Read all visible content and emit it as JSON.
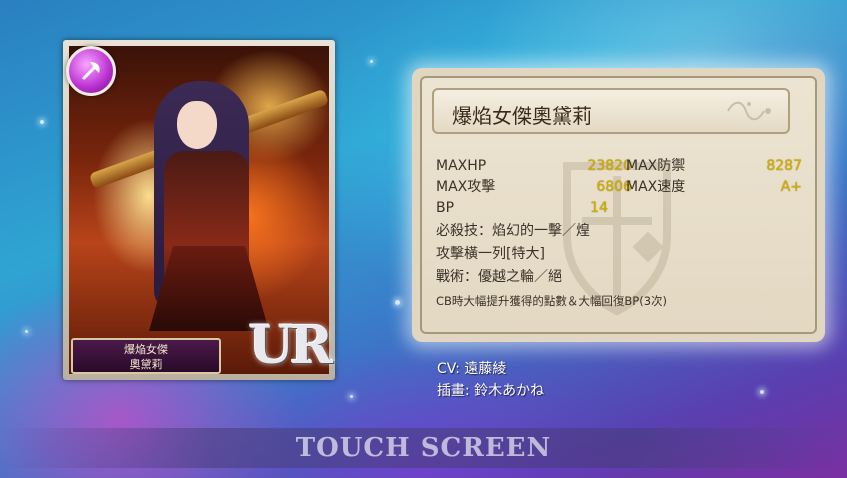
{
  "card": {
    "element_icon": "fire-axe-icon",
    "element_color": "#b92fd0",
    "nameplate_title": "爆焔女傑",
    "nameplate_name": "奧黛莉",
    "rarity": "UR"
  },
  "info": {
    "title": "爆焰女傑奧黛莉",
    "stats": {
      "maxhp_label": "MAXHP",
      "maxhp_value": "23820",
      "maxdef_label": "MAX防禦",
      "maxdef_value": "8287",
      "maxatk_label": "MAX攻擊",
      "maxatk_value": "6806",
      "maxspd_label": "MAX速度",
      "maxspd_value": "A+",
      "bp_label": "BP",
      "bp_value": "14"
    },
    "skill_line1": "必殺技：焰幻的一擊／煌",
    "skill_line2": "攻擊橫一列[特大]",
    "tactic_line": "戰術：優越之輪／絕",
    "tactic_desc": "CB時大幅提升獲得的點數＆大幅回復BP(3次)"
  },
  "credits": {
    "cv": "CV: 遠藤綾",
    "illustrator": "插畫: 鈴木あかね"
  },
  "footer": {
    "touch_label": "TOUCH SCREEN"
  }
}
